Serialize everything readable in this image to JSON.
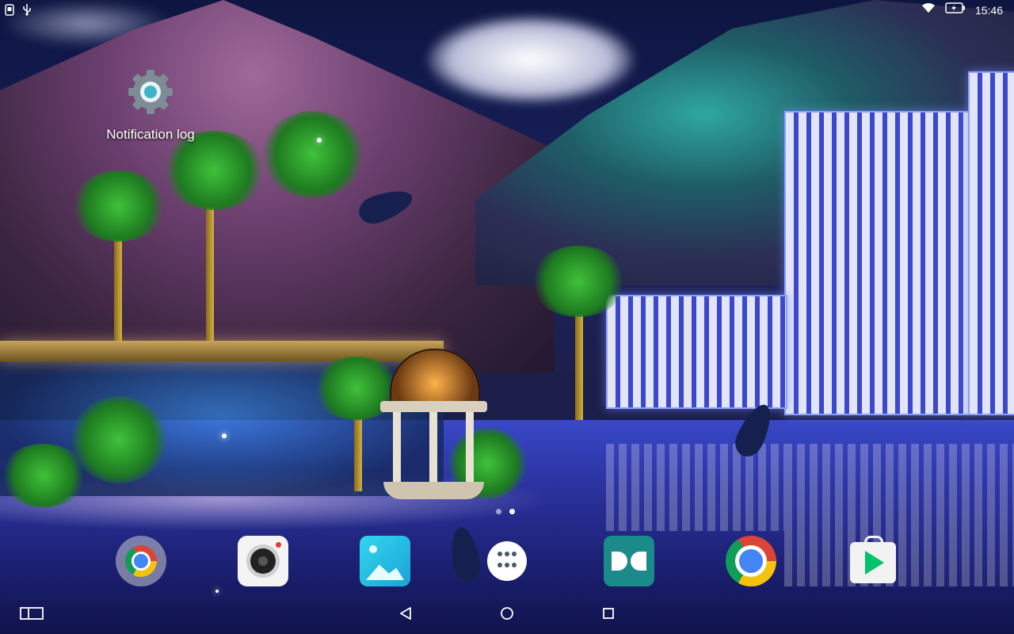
{
  "status_bar": {
    "time": "15:46",
    "left_icons": [
      "screenshot-icon",
      "usb-icon"
    ],
    "right_icons": [
      "wifi-icon",
      "battery-charging-icon"
    ]
  },
  "desktop": {
    "shortcut": {
      "label": "Notification log",
      "icon": "settings-gear-icon"
    },
    "page_indicator": {
      "pages": 2,
      "active": 2
    }
  },
  "dock": {
    "apps": [
      {
        "icon": "chrome-folder-icon"
      },
      {
        "icon": "camera-icon"
      },
      {
        "icon": "gallery-icon"
      },
      {
        "icon": "app-drawer-icon"
      },
      {
        "icon": "dolby-icon"
      },
      {
        "icon": "chrome-icon"
      },
      {
        "icon": "play-store-icon"
      }
    ]
  },
  "nav_bar": {
    "buttons": [
      "recent-windows-icon",
      "back-icon",
      "home-icon",
      "overview-icon"
    ]
  },
  "colors": {
    "dock_dolby": "#1a8a8a",
    "gallery": "#1aa3d6",
    "play_green": "#00c36a"
  }
}
